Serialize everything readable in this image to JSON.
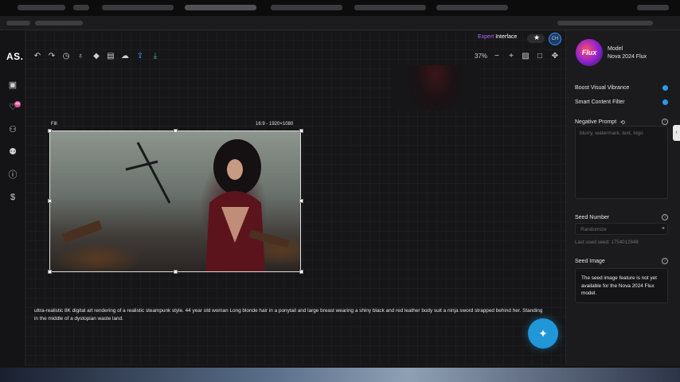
{
  "header": {
    "expert_label": "Expert",
    "interface_label": "Interface",
    "star_icon": "star-icon",
    "avatar_initials": "CH"
  },
  "sidebar": {
    "logo": "AS.",
    "icons": [
      "image-icon",
      "heart-icon",
      "user-icon",
      "users-icon",
      "info-icon",
      "dollar-icon"
    ],
    "badge_count": "44"
  },
  "toolbar": {
    "icons": [
      "undo-icon",
      "redo-icon",
      "history-icon",
      "bulb-icon",
      "eraser-icon",
      "bag-icon",
      "cloud-upload-icon",
      "upload-icon",
      "download-icon"
    ],
    "zoom": "37%",
    "zoom_out": "−",
    "zoom_in": "+"
  },
  "canvas": {
    "fill_label": "Fill",
    "ratio_label": "16:9 - 1920×1080",
    "prompt": "ultra-realistic 8K digital art rendering of a realistic steampunk style. 44 year old woman Long blonde hair in a ponytail and large breast wearing a shiny black and red leather body suit a ninja sword strapped behind her. Standing in the middle of a dystopian waste land."
  },
  "right_panel": {
    "model_title": "Model",
    "model_name": "Nova 2024 Flux",
    "model_logo_text": "Flux",
    "boost_label": "Boost Visual Vibrance",
    "boost_on": true,
    "filter_label": "Smart Content Filter",
    "filter_on": true,
    "negative_title": "Negative Prompt",
    "negative_placeholder": "blurry, watermark, text, logo",
    "seed_title": "Seed Number",
    "seed_placeholder": "Randomize",
    "seed_clear": "×",
    "last_seed": "Last used seed: 1754012848",
    "seed_image_title": "Seed Image",
    "seed_image_note": "The seed image feature is not yet available for the Nova 2024 Flux model."
  },
  "colors": {
    "accent": "#2a9bea",
    "fab": "#1f97d8",
    "expert": "#b46bff"
  }
}
